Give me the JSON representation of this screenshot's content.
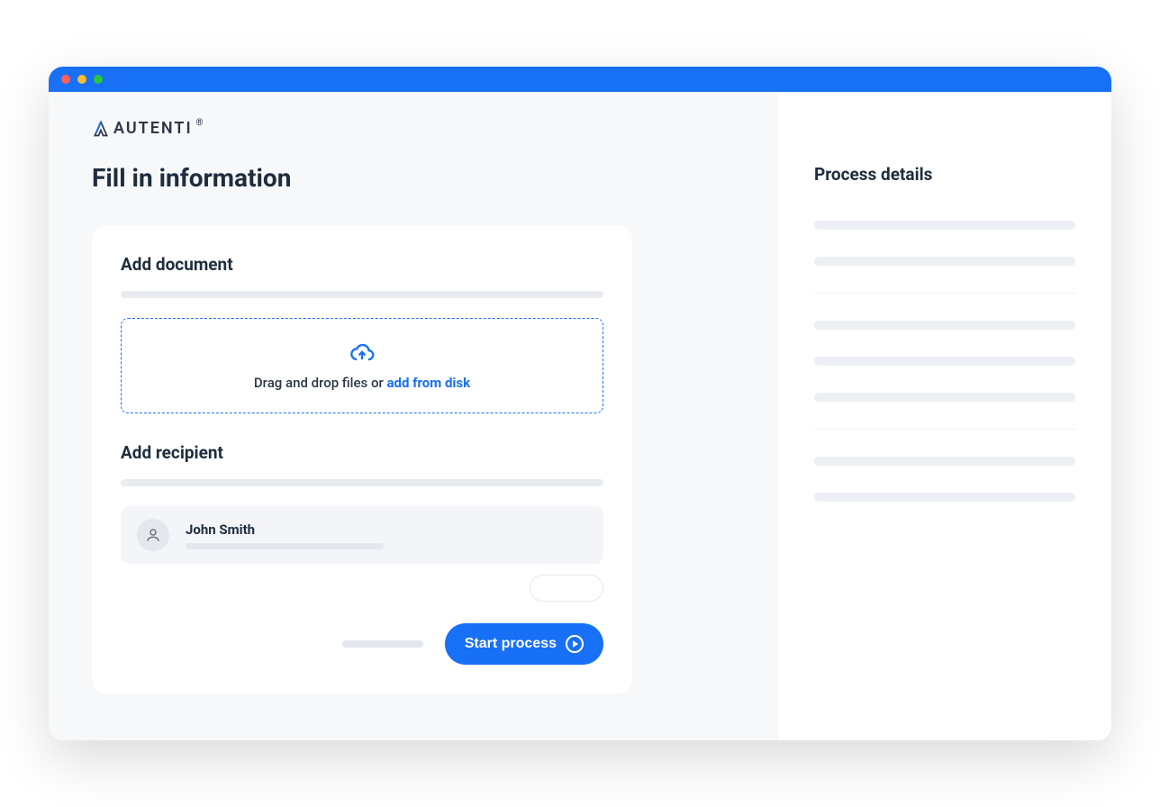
{
  "brand": "AUTENTI",
  "header": {
    "title": "Fill in information"
  },
  "sections": {
    "add_document": {
      "title": "Add document",
      "dropzone_prefix": "Drag and drop files or ",
      "dropzone_link": "add from disk"
    },
    "add_recipient": {
      "title": "Add recipient",
      "recipient_name": "John Smith"
    }
  },
  "actions": {
    "start": "Start process"
  },
  "sidebar": {
    "title": "Process details"
  }
}
